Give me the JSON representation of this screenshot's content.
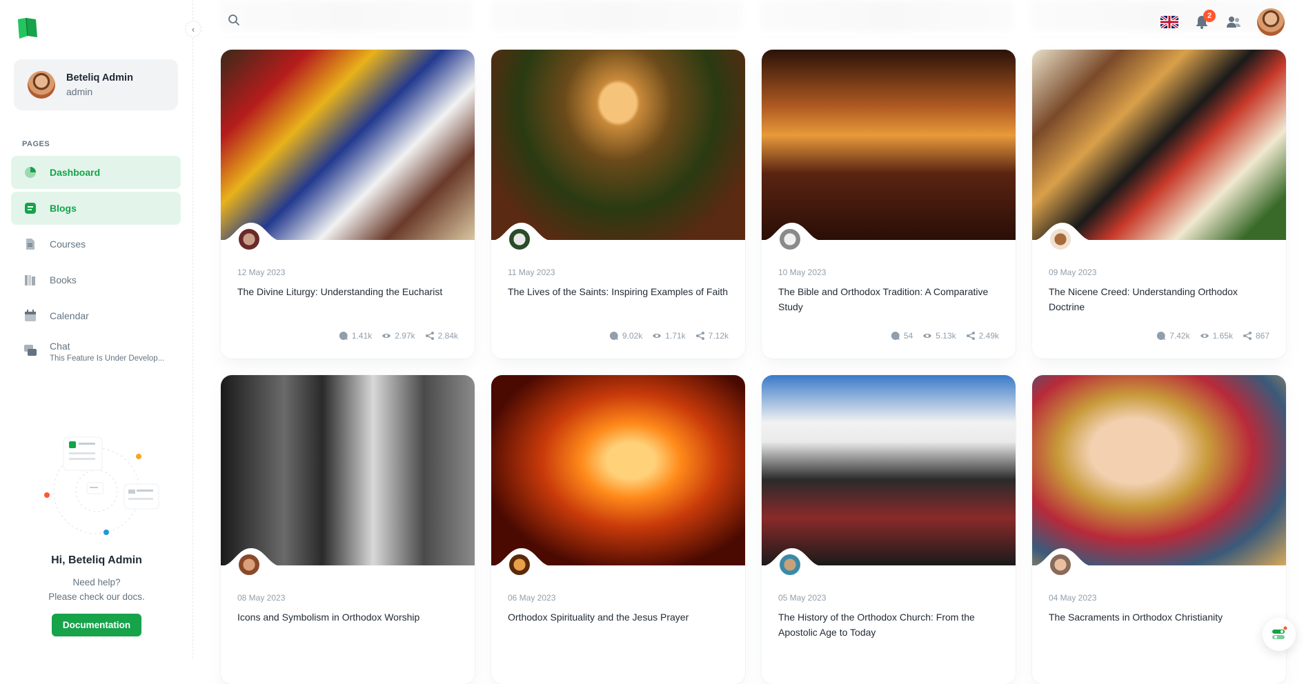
{
  "user": {
    "name": "Beteliq Admin",
    "role": "admin"
  },
  "nav": {
    "subheader": "PAGES",
    "items": [
      {
        "label": "Dashboard",
        "icon": "dashboard-icon"
      },
      {
        "label": "Blogs",
        "icon": "blog-icon"
      },
      {
        "label": "Courses",
        "icon": "courses-icon"
      },
      {
        "label": "Books",
        "icon": "books-icon"
      },
      {
        "label": "Calendar",
        "icon": "calendar-icon"
      },
      {
        "label": "Chat",
        "icon": "chat-icon",
        "caption": "This Feature Is Under Develop..."
      }
    ]
  },
  "help_card": {
    "greeting": "Hi, Beteliq Admin",
    "line1": "Need help?",
    "line2": "Please check our docs.",
    "button": "Documentation"
  },
  "header": {
    "notifications_count": "2"
  },
  "colors": {
    "accent": "#16a34a",
    "accent_light": "#e3f5ea",
    "badge": "#ff5630"
  },
  "posts": [
    {
      "date": "12 May 2023",
      "title": "The Divine Liturgy: Understanding the Eucharist",
      "comments": "1.41k",
      "views": "2.97k",
      "shares": "2.84k"
    },
    {
      "date": "11 May 2023",
      "title": "The Lives of the Saints: Inspiring Examples of Faith",
      "comments": "9.02k",
      "views": "1.71k",
      "shares": "7.12k"
    },
    {
      "date": "10 May 2023",
      "title": "The Bible and Orthodox Tradition: A Comparative Study",
      "comments": "54",
      "views": "5.13k",
      "shares": "2.49k"
    },
    {
      "date": "09 May 2023",
      "title": "The Nicene Creed: Understanding Orthodox Doctrine",
      "comments": "7.42k",
      "views": "1.65k",
      "shares": "867"
    },
    {
      "date": "08 May 2023",
      "title": "Icons and Symbolism in Orthodox Worship",
      "comments": "",
      "views": "",
      "shares": ""
    },
    {
      "date": "06 May 2023",
      "title": "Orthodox Spirituality and the Jesus Prayer",
      "comments": "",
      "views": "",
      "shares": ""
    },
    {
      "date": "05 May 2023",
      "title": "The History of the Orthodox Church: From the Apostolic Age to Today",
      "comments": "",
      "views": "",
      "shares": ""
    },
    {
      "date": "04 May 2023",
      "title": "The Sacraments in Orthodox Christianity",
      "comments": "",
      "views": "",
      "shares": ""
    }
  ]
}
